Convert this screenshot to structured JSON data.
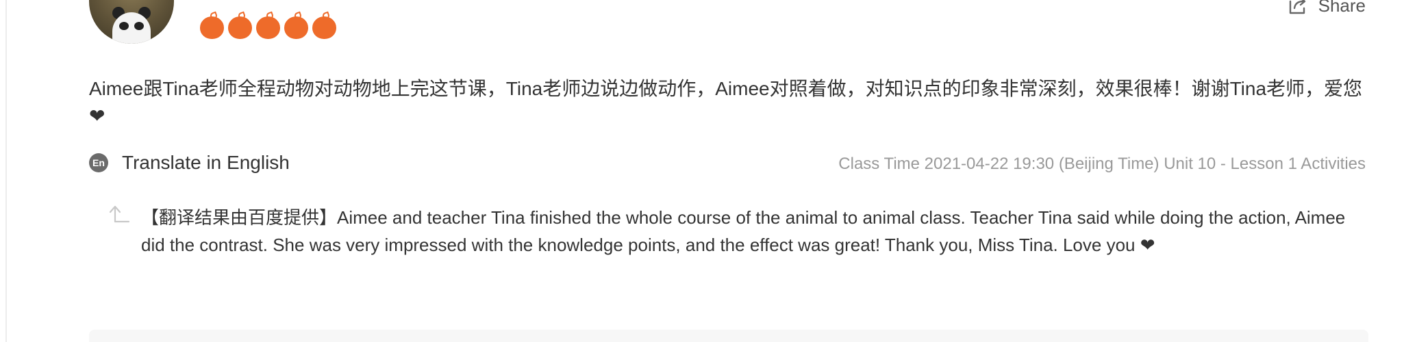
{
  "rating": {
    "value": 5,
    "max": 5,
    "icon": "peach-icon",
    "color": "#ee6b2a"
  },
  "share": {
    "label": "Share"
  },
  "review": {
    "text": "Aimee跟Tina老师全程动物对动物地上完这节课，Tina老师边说边做动作，Aimee对照着做，对知识点的印象非常深刻，效果很棒！谢谢Tina老师，爱您❤"
  },
  "translate": {
    "icon_text": "En",
    "label": "Translate in English"
  },
  "class_time": "Class Time 2021-04-22 19:30 (Beijing Time) Unit 10 - Lesson 1 Activities",
  "translation": {
    "text": "【翻译结果由百度提供】Aimee and teacher Tina finished the whole course of the animal to animal class. Teacher Tina said while doing the action, Aimee did the contrast. She was very impressed with the knowledge points, and the effect was great! Thank you, Miss Tina. Love you ❤"
  }
}
